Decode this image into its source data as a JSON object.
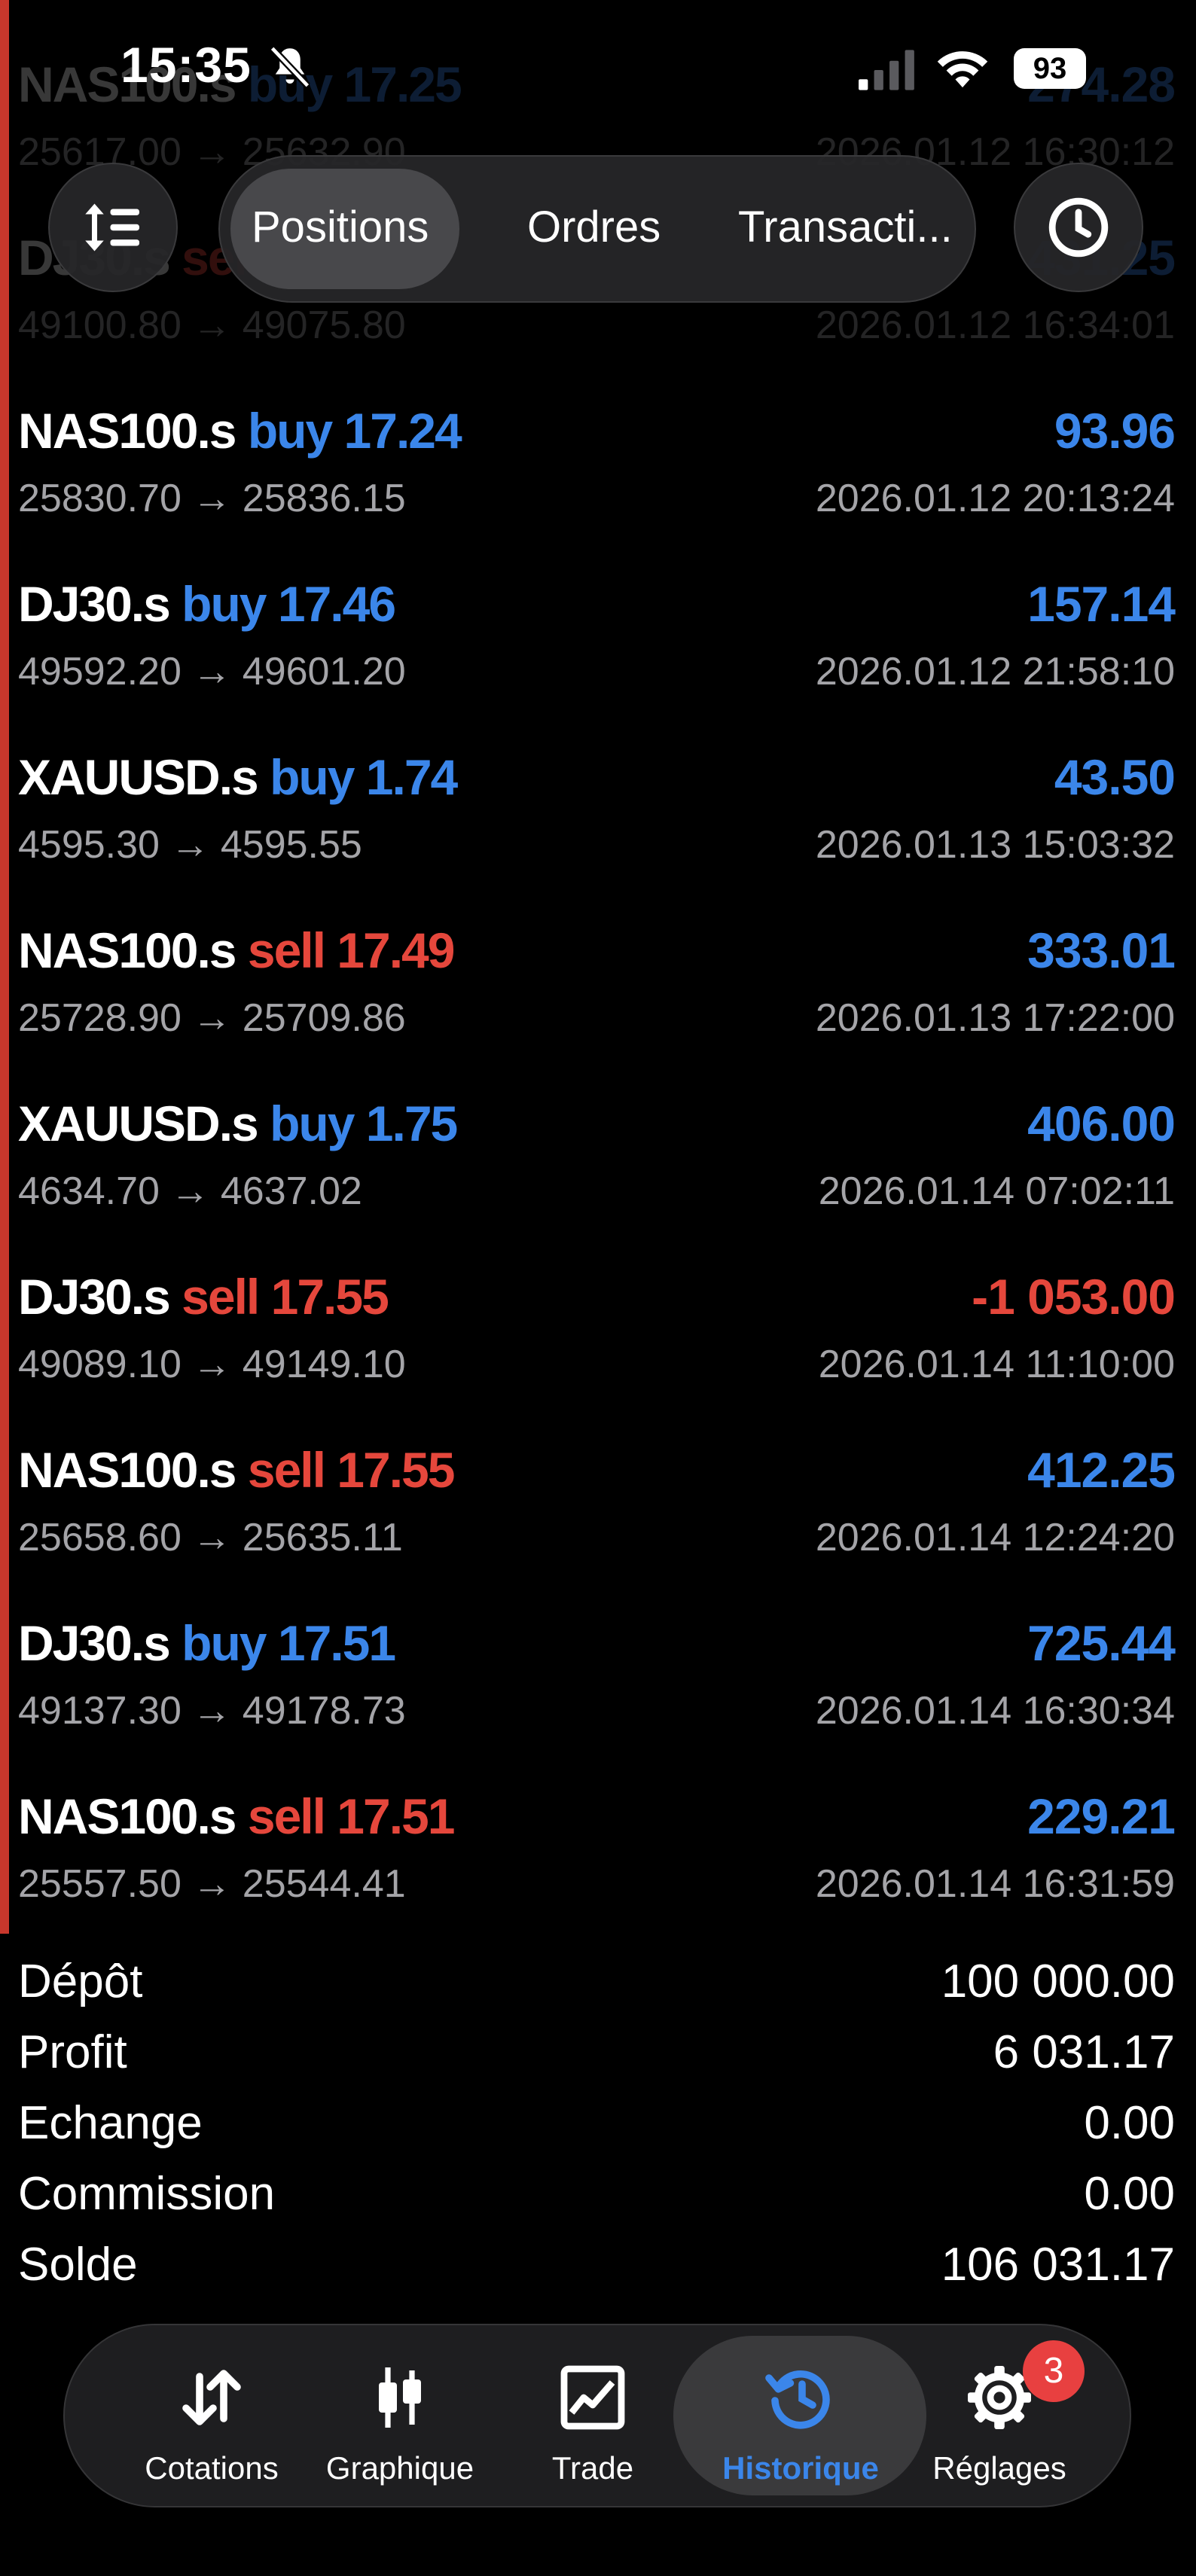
{
  "status_bar": {
    "time": "15:35",
    "battery": "93"
  },
  "top_bar": {
    "tabs": [
      {
        "label": "Positions"
      },
      {
        "label": "Ordres"
      },
      {
        "label": "Transacti..."
      }
    ],
    "active_tab": "Positions"
  },
  "trades": [
    {
      "symbol": "NAS100.s",
      "side": "buy",
      "volume": "17.25",
      "prices": "25617.00 → 25632.90",
      "profit": "274.28",
      "profit_color": "blue",
      "time": "2026.01.12 16:30:12"
    },
    {
      "symbol": "DJ30.s",
      "side": "sell",
      "volume": "17.25",
      "prices": "49100.80 → 49075.80",
      "profit": "431.25",
      "profit_color": "blue",
      "time": "2026.01.12 16:34:01"
    },
    {
      "symbol": "NAS100.s",
      "side": "buy",
      "volume": "17.24",
      "prices": "25830.70 → 25836.15",
      "profit": "93.96",
      "profit_color": "blue",
      "time": "2026.01.12 20:13:24"
    },
    {
      "symbol": "DJ30.s",
      "side": "buy",
      "volume": "17.46",
      "prices": "49592.20 → 49601.20",
      "profit": "157.14",
      "profit_color": "blue",
      "time": "2026.01.12 21:58:10"
    },
    {
      "symbol": "XAUUSD.s",
      "side": "buy",
      "volume": "1.74",
      "prices": "4595.30 → 4595.55",
      "profit": "43.50",
      "profit_color": "blue",
      "time": "2026.01.13 15:03:32"
    },
    {
      "symbol": "NAS100.s",
      "side": "sell",
      "volume": "17.49",
      "prices": "25728.90 → 25709.86",
      "profit": "333.01",
      "profit_color": "blue",
      "time": "2026.01.13 17:22:00"
    },
    {
      "symbol": "XAUUSD.s",
      "side": "buy",
      "volume": "1.75",
      "prices": "4634.70 → 4637.02",
      "profit": "406.00",
      "profit_color": "blue",
      "time": "2026.01.14 07:02:11"
    },
    {
      "symbol": "DJ30.s",
      "side": "sell",
      "volume": "17.55",
      "prices": "49089.10 → 49149.10",
      "profit": "-1 053.00",
      "profit_color": "red",
      "time": "2026.01.14 11:10:00"
    },
    {
      "symbol": "NAS100.s",
      "side": "sell",
      "volume": "17.55",
      "prices": "25658.60 → 25635.11",
      "profit": "412.25",
      "profit_color": "blue",
      "time": "2026.01.14 12:24:20"
    },
    {
      "symbol": "DJ30.s",
      "side": "buy",
      "volume": "17.51",
      "prices": "49137.30 → 49178.73",
      "profit": "725.44",
      "profit_color": "blue",
      "time": "2026.01.14 16:30:34"
    },
    {
      "symbol": "NAS100.s",
      "side": "sell",
      "volume": "17.51",
      "prices": "25557.50 → 25544.41",
      "profit": "229.21",
      "profit_color": "blue",
      "time": "2026.01.14 16:31:59"
    }
  ],
  "summary": [
    {
      "label": "Dépôt",
      "value": "100 000.00"
    },
    {
      "label": "Profit",
      "value": "6 031.17"
    },
    {
      "label": "Echange",
      "value": "0.00"
    },
    {
      "label": "Commission",
      "value": "0.00"
    },
    {
      "label": "Solde",
      "value": "106 031.17"
    }
  ],
  "tabbar": {
    "items": [
      {
        "label": "Cotations",
        "icon": "arrows-up-down-icon"
      },
      {
        "label": "Graphique",
        "icon": "candlestick-icon"
      },
      {
        "label": "Trade",
        "icon": "trade-chart-icon"
      },
      {
        "label": "Historique",
        "icon": "history-icon"
      },
      {
        "label": "Réglages",
        "icon": "gear-icon"
      }
    ],
    "active": "Historique",
    "settings_badge": "3"
  },
  "colors": {
    "buy": "#3b86ea",
    "sell": "#e5473c",
    "accent_bar": "#c8372c",
    "background": "#000000"
  }
}
